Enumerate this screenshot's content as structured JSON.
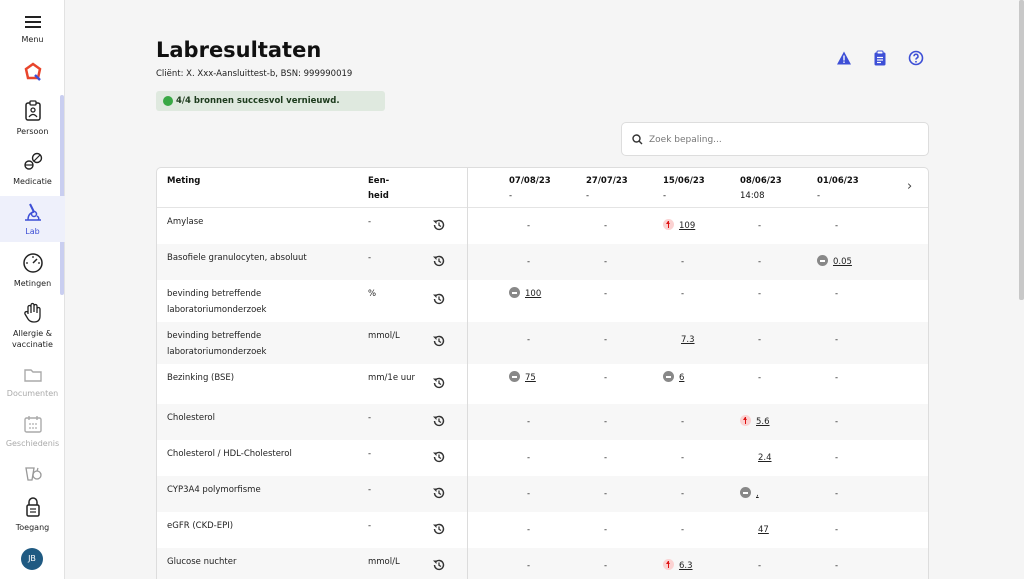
{
  "sidebar": {
    "menu_label": "Menu",
    "items": [
      {
        "label": "Persoon",
        "icon": "person-clipboard-icon",
        "state": "normal"
      },
      {
        "label": "Medicatie",
        "icon": "pills-icon",
        "state": "normal"
      },
      {
        "label": "Lab",
        "icon": "microscope-icon",
        "state": "active"
      },
      {
        "label": "Metingen",
        "icon": "gauge-icon",
        "state": "normal"
      },
      {
        "label": "Allergie & vaccinatie",
        "icon": "hand-icon",
        "state": "normal"
      },
      {
        "label": "Documenten",
        "icon": "folder-icon",
        "state": "disabled"
      },
      {
        "label": "Geschiedenis",
        "icon": "calendar-icon",
        "state": "disabled"
      },
      {
        "label": "Toegang",
        "icon": "lock-icon",
        "state": "normal"
      }
    ],
    "avatar_initials": "JB",
    "accent_color": "#3d4fd6"
  },
  "page": {
    "title": "Labresultaten",
    "subtitle": "Cliënt: X. Xxx-Aansluittest-b, BSN: 999990019",
    "status": "4/4 bronnen succesvol vernieuwd.",
    "status_color": "#39a845"
  },
  "header_icons": [
    "warning-icon",
    "clipboard-icon",
    "help-icon"
  ],
  "search": {
    "placeholder": "Zoek bepaling..."
  },
  "table": {
    "col_meting": "Meting",
    "col_eenheid_1": "Een-",
    "col_eenheid_2": "heid",
    "dates": [
      {
        "date": "07/08/23",
        "time": "-"
      },
      {
        "date": "27/07/23",
        "time": "-"
      },
      {
        "date": "15/06/23",
        "time": "-"
      },
      {
        "date": "08/06/23",
        "time": "14:08"
      },
      {
        "date": "01/06/23",
        "time": "-"
      }
    ],
    "rows": [
      {
        "name": "Amylase",
        "unit": "-",
        "values": [
          {
            "v": "-"
          },
          {
            "v": "-"
          },
          {
            "v": "109",
            "flag": "up"
          },
          {
            "v": "-"
          },
          {
            "v": "-"
          }
        ]
      },
      {
        "name": "Basofiele granulocyten, absoluut",
        "unit": "-",
        "values": [
          {
            "v": "-"
          },
          {
            "v": "-"
          },
          {
            "v": "-"
          },
          {
            "v": "-"
          },
          {
            "v": "0.05",
            "flag": "neutral"
          }
        ]
      },
      {
        "name": "bevinding betreffende laboratoriumonderzoek",
        "unit": "%",
        "values": [
          {
            "v": "100",
            "flag": "neutral"
          },
          {
            "v": "-"
          },
          {
            "v": "-"
          },
          {
            "v": "-"
          },
          {
            "v": "-"
          }
        ]
      },
      {
        "name": "bevinding betreffende laboratoriumonderzoek",
        "unit": "mmol/L",
        "values": [
          {
            "v": "-"
          },
          {
            "v": "-"
          },
          {
            "v": "7.3",
            "flag": "none"
          },
          {
            "v": "-"
          },
          {
            "v": "-"
          }
        ]
      },
      {
        "name": "Bezinking (BSE)",
        "unit": "mm/1e uur",
        "values": [
          {
            "v": "75",
            "flag": "neutral"
          },
          {
            "v": "-"
          },
          {
            "v": "6",
            "flag": "neutral"
          },
          {
            "v": "-"
          },
          {
            "v": "-"
          }
        ]
      },
      {
        "name": "Cholesterol",
        "unit": "-",
        "values": [
          {
            "v": "-"
          },
          {
            "v": "-"
          },
          {
            "v": "-"
          },
          {
            "v": "5.6",
            "flag": "up"
          },
          {
            "v": "-"
          }
        ]
      },
      {
        "name": "Cholesterol / HDL-Cholesterol",
        "unit": "-",
        "values": [
          {
            "v": "-"
          },
          {
            "v": "-"
          },
          {
            "v": "-"
          },
          {
            "v": "2.4",
            "flag": "none"
          },
          {
            "v": "-"
          }
        ]
      },
      {
        "name": "CYP3A4 polymorfisme",
        "unit": "-",
        "values": [
          {
            "v": "-"
          },
          {
            "v": "-"
          },
          {
            "v": "-"
          },
          {
            "v": ",",
            "flag": "neutral"
          },
          {
            "v": "-"
          }
        ]
      },
      {
        "name": "eGFR (CKD-EPI)",
        "unit": "-",
        "values": [
          {
            "v": "-"
          },
          {
            "v": "-"
          },
          {
            "v": "-"
          },
          {
            "v": "47",
            "flag": "none"
          },
          {
            "v": "-"
          }
        ]
      },
      {
        "name": "Glucose nuchter",
        "unit": "mmol/L",
        "values": [
          {
            "v": "-"
          },
          {
            "v": "-"
          },
          {
            "v": "6.3",
            "flag": "up"
          },
          {
            "v": "-"
          },
          {
            "v": "-"
          }
        ]
      }
    ]
  }
}
